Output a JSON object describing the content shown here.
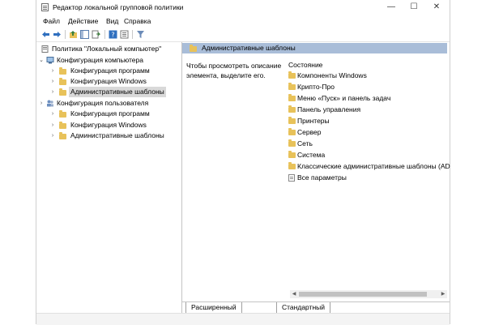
{
  "window": {
    "title": "Редактор локальной групповой политики",
    "minimize_glyph": "—",
    "maximize_glyph": "☐",
    "close_glyph": "✕"
  },
  "menu": [
    "Файл",
    "Действие",
    "Вид",
    "Справка"
  ],
  "toolbar": {
    "icons": [
      "back-arrow-icon",
      "forward-arrow-icon",
      "up-folder-icon",
      "show-hide-tree-icon",
      "export-list-icon",
      "help-icon",
      "properties-icon",
      "filter-icon"
    ]
  },
  "tree": {
    "root": "Политика \"Локальный компьютер\"",
    "computer_config": {
      "label": "Конфигурация компьютера",
      "children": [
        "Конфигурация программ",
        "Конфигурация Windows",
        "Административные шаблоны"
      ]
    },
    "user_config": {
      "label": "Конфигурация пользователя",
      "children": [
        "Конфигурация программ",
        "Конфигурация Windows",
        "Административные шаблоны"
      ]
    },
    "expanded_chevron": "⌄",
    "collapsed_chevron": "›"
  },
  "details": {
    "header": "Административные шаблоны",
    "description": "Чтобы просмотреть описание элемента, выделите его.",
    "column_status": "Состояние",
    "items": [
      "Компоненты Windows",
      "Крипто-Про",
      "Меню «Пуск» и панель задач",
      "Панель управления",
      "Принтеры",
      "Сервер",
      "Сеть",
      "Система",
      "Классические административные шаблоны (AD",
      "Все параметры"
    ]
  },
  "tabs": [
    "Расширенный",
    "Стандартный"
  ],
  "colors": {
    "header_band": "#a9bdd8",
    "folder": "#e8c25a",
    "selection": "#d9d9d9"
  }
}
